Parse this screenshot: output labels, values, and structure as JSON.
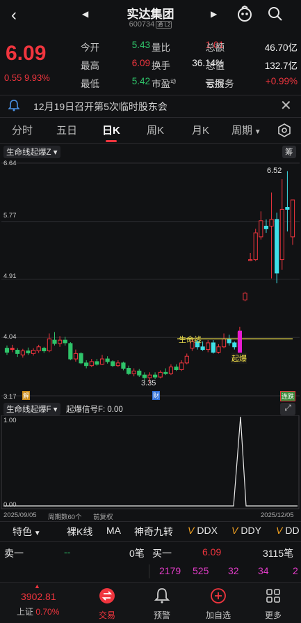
{
  "header": {
    "title": "实达集团",
    "code": "600734",
    "code_tag": "通 L2"
  },
  "quote": {
    "price": "6.09",
    "change": "0.55",
    "change_pct": "9.93%",
    "rows": [
      [
        {
          "label": "今开",
          "value": "5.43",
          "c": "green"
        },
        {
          "label": "量比",
          "value": "1.01",
          "c": "red"
        },
        {
          "label": "总额",
          "value": "46.70亿",
          "c": "white"
        }
      ],
      [
        {
          "label": "最高",
          "value": "6.09",
          "c": "red"
        },
        {
          "label": "换手",
          "value": "36.14%",
          "c": "white"
        },
        {
          "label": "总值",
          "value": "132.7亿",
          "c": "white"
        }
      ],
      [
        {
          "label": "最低",
          "value": "5.42",
          "c": "green"
        },
        {
          "label": "市盈",
          "sup": "动",
          "value": "亏损",
          "c": "white"
        },
        {
          "label": "云服务",
          "value": "+0.99%",
          "c": "red"
        }
      ]
    ]
  },
  "notice": {
    "text": "12月19日召开第5次临时股东会"
  },
  "tabs": [
    "分时",
    "五日",
    "日K",
    "周K",
    "月K",
    "周期"
  ],
  "chart_main": {
    "indicator": "生命线起爆Z",
    "right_btn": "筹",
    "y_ticks": [
      "6.64",
      "5.77",
      "4.91",
      "4.04",
      "3.17"
    ],
    "annot_high": "6.52",
    "annot_low": "3.35",
    "life_label": "生命线",
    "boom_label": "起爆",
    "mark_jie": "解",
    "mark_cai": "财",
    "mark_lian": "连跌"
  },
  "chart_sub": {
    "indicator": "生命线起爆F",
    "signal": "起爆信号F: 0.00",
    "y_top": "1.00",
    "y_bottom": "0.00",
    "date_left": "2025/09/05",
    "period": "周期数60个",
    "fq": "前复权",
    "date_right": "2025/12/05"
  },
  "chart_data": {
    "type": "candlestick",
    "ylim": [
      3.17,
      6.64
    ],
    "life_line": 4.02,
    "candles": [
      [
        3.82,
        3.88,
        3.92,
        3.78
      ],
      [
        3.88,
        3.86,
        3.93,
        3.82
      ],
      [
        3.85,
        3.8,
        3.88,
        3.75
      ],
      [
        3.78,
        3.84,
        3.87,
        3.74
      ],
      [
        3.84,
        3.81,
        3.89,
        3.78
      ],
      [
        3.8,
        3.85,
        3.88,
        3.77
      ],
      [
        3.84,
        3.9,
        3.93,
        3.81
      ],
      [
        3.88,
        3.84,
        3.9,
        3.81
      ],
      [
        3.84,
        4.02,
        4.1,
        3.82
      ],
      [
        4.0,
        3.95,
        4.12,
        3.92
      ],
      [
        3.95,
        4.0,
        4.06,
        3.9
      ],
      [
        4.0,
        3.96,
        4.05,
        3.92
      ],
      [
        3.95,
        3.72,
        3.97,
        3.7
      ],
      [
        3.72,
        3.8,
        3.86,
        3.68
      ],
      [
        3.8,
        3.66,
        3.82,
        3.64
      ],
      [
        3.66,
        3.62,
        3.7,
        3.58
      ],
      [
        3.62,
        3.68,
        3.72,
        3.6
      ],
      [
        3.68,
        3.64,
        3.72,
        3.62
      ],
      [
        3.64,
        3.72,
        3.78,
        3.63
      ],
      [
        3.72,
        3.68,
        3.76,
        3.65
      ],
      [
        3.68,
        3.62,
        3.7,
        3.6
      ],
      [
        3.62,
        3.66,
        3.7,
        3.6
      ],
      [
        3.66,
        3.58,
        3.68,
        3.55
      ],
      [
        3.58,
        3.5,
        3.62,
        3.48
      ],
      [
        3.5,
        3.54,
        3.58,
        3.46
      ],
      [
        3.54,
        3.48,
        3.57,
        3.45
      ],
      [
        3.48,
        3.44,
        3.52,
        3.4
      ],
      [
        3.44,
        3.48,
        3.52,
        3.35
      ],
      [
        3.48,
        3.45,
        3.52,
        3.42
      ],
      [
        3.45,
        3.52,
        3.55,
        3.43
      ],
      [
        3.52,
        3.5,
        3.58,
        3.48
      ],
      [
        3.5,
        3.6,
        3.64,
        3.48
      ],
      [
        3.6,
        3.56,
        3.64,
        3.54
      ],
      [
        3.56,
        3.66,
        3.7,
        3.54
      ],
      [
        3.66,
        3.76,
        3.8,
        3.64
      ],
      [
        3.88,
        3.98,
        4.02,
        3.84
      ],
      [
        3.98,
        3.9,
        4.0,
        3.86
      ],
      [
        3.9,
        3.86,
        3.98,
        3.84
      ],
      [
        3.86,
        3.96,
        4.0,
        3.82
      ],
      [
        3.96,
        3.82,
        4.0,
        3.8
      ],
      [
        3.82,
        3.9,
        3.94,
        3.8
      ],
      [
        3.9,
        4.02,
        4.1,
        3.88
      ],
      [
        4.02,
        3.96,
        4.08,
        3.92
      ],
      [
        3.96,
        3.9,
        3.98,
        3.86
      ],
      [
        3.9,
        4.12,
        4.2,
        3.88
      ],
      [
        4.6,
        4.7,
        4.72,
        4.58
      ],
      [
        5.2,
        5.2,
        5.3,
        5.18
      ],
      [
        5.2,
        5.6,
        5.66,
        5.18
      ],
      [
        5.54,
        5.78,
        5.92,
        5.5
      ],
      [
        5.7,
        5.66,
        5.8,
        5.6
      ],
      [
        5.7,
        5.8,
        6.2,
        4.92
      ],
      [
        5.8,
        5.0,
        5.9,
        4.85
      ],
      [
        5.2,
        5.95,
        6.4,
        5.05
      ],
      [
        5.95,
        5.98,
        6.52,
        5.62
      ],
      [
        5.54,
        6.09,
        6.09,
        5.42
      ]
    ],
    "colors": [
      "green",
      "red",
      "green",
      "red",
      "green",
      "red",
      "red",
      "green",
      "red",
      "green",
      "red",
      "green",
      "green",
      "red",
      "green",
      "green",
      "red",
      "green",
      "red",
      "green",
      "green",
      "red",
      "green",
      "green",
      "red",
      "green",
      "green",
      "red",
      "green",
      "red",
      "green",
      "red",
      "green",
      "red",
      "red",
      "red",
      "cyan",
      "cyan",
      "red",
      "cyan",
      "red",
      "red",
      "cyan",
      "cyan",
      "red",
      "red",
      "red",
      "red",
      "red",
      "cyan",
      "red",
      "cyan",
      "red",
      "cyan",
      "red"
    ]
  },
  "toolbar": [
    "特色",
    "裸K线",
    "MA",
    "神奇九转",
    "DDX",
    "DDY",
    "DD"
  ],
  "book": {
    "sell_label": "卖一",
    "sell_price": "--",
    "sell_vol": "0笔",
    "buy_label": "买一",
    "buy_price": "6.09",
    "buy_vol": "3115笔",
    "nums": [
      "2179",
      "525",
      "32",
      "34",
      "2"
    ]
  },
  "bottom": {
    "index_value": "3902.81",
    "index_name": "上证",
    "index_pct": "0.70%",
    "items": [
      "交易",
      "预警",
      "加自选",
      "更多"
    ]
  }
}
